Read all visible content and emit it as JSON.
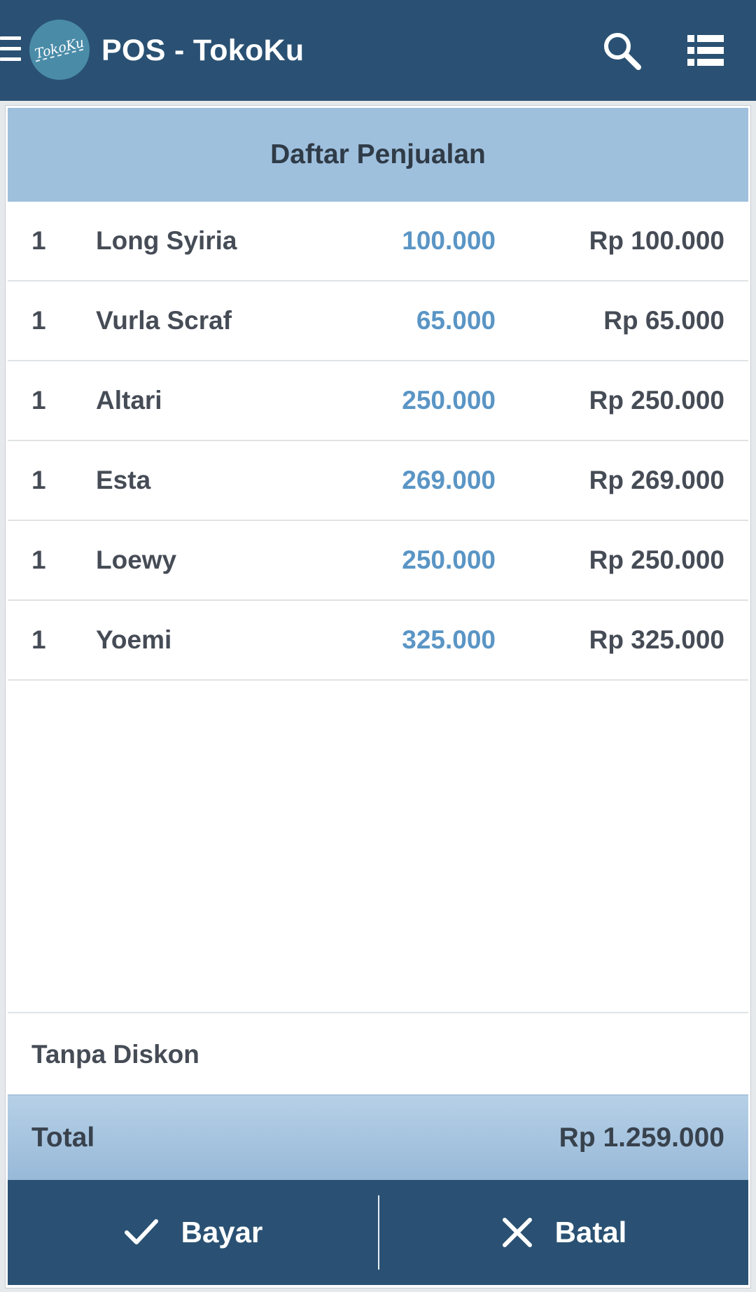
{
  "app": {
    "title": "POS - TokoKu",
    "logo_text": "TokoKu",
    "icons": [
      "menu-icon",
      "search-icon",
      "list-view-icon"
    ]
  },
  "panel": {
    "title": "Daftar Penjualan"
  },
  "items": [
    {
      "qty": "1",
      "name": "Long Syiria",
      "price": "100.000",
      "subtotal": "Rp 100.000"
    },
    {
      "qty": "1",
      "name": "Vurla Scraf",
      "price": "65.000",
      "subtotal": "Rp 65.000"
    },
    {
      "qty": "1",
      "name": "Altari",
      "price": "250.000",
      "subtotal": "Rp 250.000"
    },
    {
      "qty": "1",
      "name": "Esta",
      "price": "269.000",
      "subtotal": "Rp 269.000"
    },
    {
      "qty": "1",
      "name": "Loewy",
      "price": "250.000",
      "subtotal": "Rp 250.000"
    },
    {
      "qty": "1",
      "name": "Yoemi",
      "price": "325.000",
      "subtotal": "Rp 325.000"
    }
  ],
  "discount": {
    "label": "Tanpa Diskon"
  },
  "total": {
    "label": "Total",
    "value": "Rp 1.259.000"
  },
  "actions": {
    "pay_label": "Bayar",
    "pay_icon": "check-icon",
    "cancel_label": "Batal",
    "cancel_icon": "close-icon"
  },
  "colors": {
    "header_bg": "#2a5173",
    "panel_header_bg": "#9fc0dd",
    "price_text": "#5a95c5",
    "body_text": "#464c56"
  }
}
